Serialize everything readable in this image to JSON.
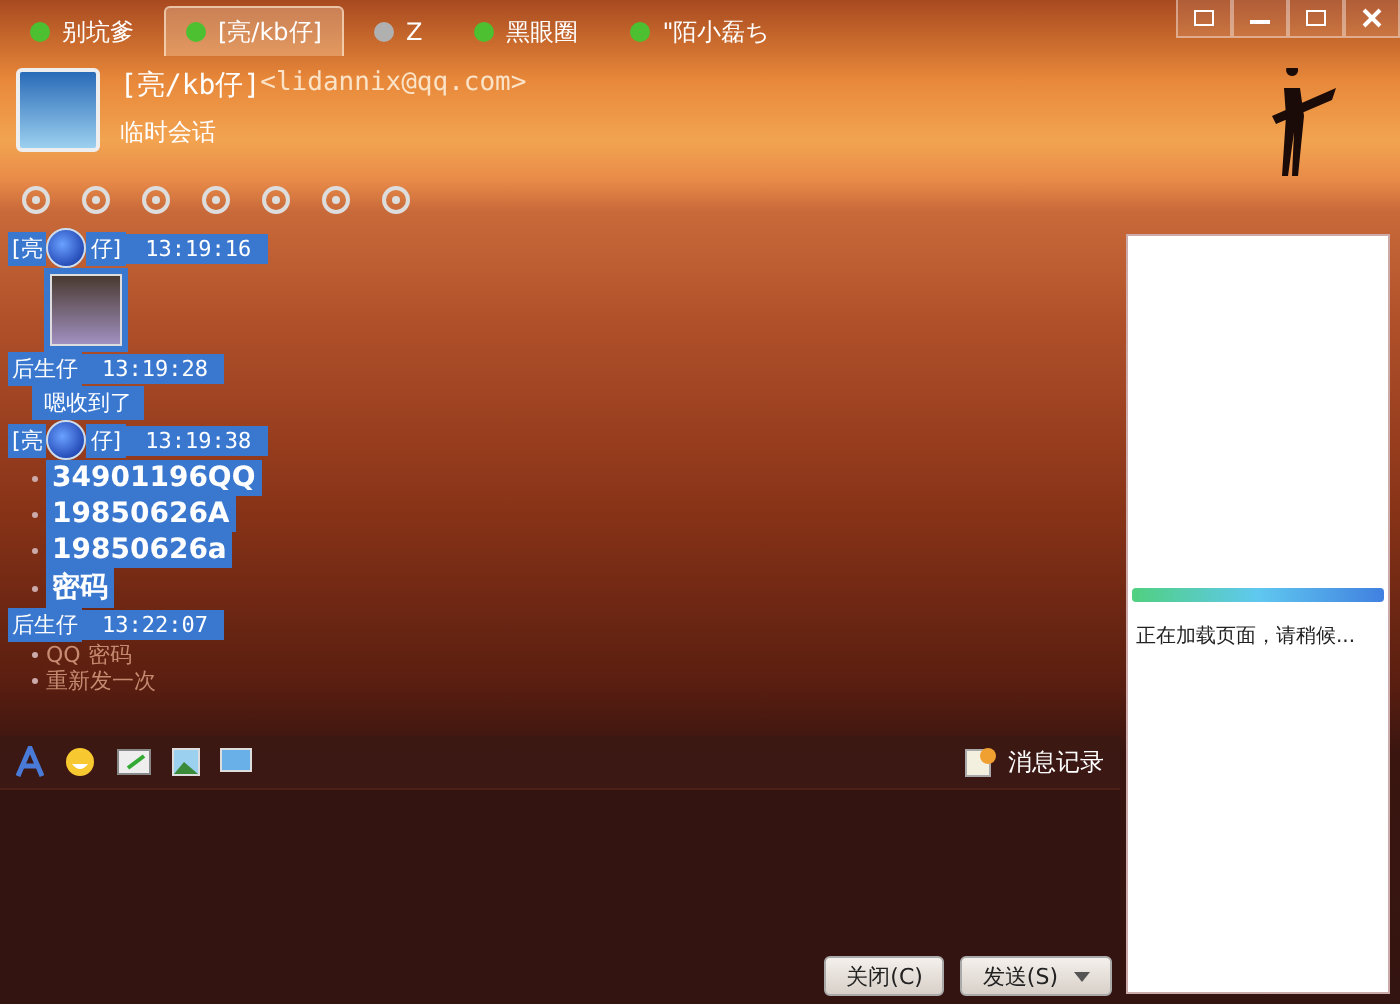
{
  "tabs": [
    {
      "label": "别坑爹",
      "color": "#4cc030",
      "selected": false
    },
    {
      "label": "[亮/kb仔]",
      "color": "#4cc030",
      "selected": true
    },
    {
      "label": "Z",
      "color": "#b0b0b0",
      "selected": false
    },
    {
      "label": "黑眼圈",
      "color": "#4cc030",
      "selected": false
    },
    {
      "label": "\"陌小磊ち",
      "color": "#4cc030",
      "selected": false
    }
  ],
  "contact": {
    "name": "[亮/kb仔]",
    "email": "<lidannix@qq.com>",
    "subtitle": "临时会话"
  },
  "messages": [
    {
      "sender": "[亮",
      "sender_tail": "仔]",
      "time": "13:19:16",
      "lines": [
        {
          "kind": "image"
        }
      ]
    },
    {
      "sender": "后生仔",
      "time": "13:19:28",
      "lines": [
        {
          "kind": "text",
          "text": "嗯收到了"
        }
      ]
    },
    {
      "sender": "[亮",
      "sender_tail": "仔]",
      "time": "13:19:38",
      "lines": [
        {
          "kind": "bullet",
          "text": "34901196QQ"
        },
        {
          "kind": "bullet",
          "text": "19850626A"
        },
        {
          "kind": "bullet",
          "text": "19850626a"
        },
        {
          "kind": "bullet",
          "text": "密码"
        }
      ]
    },
    {
      "sender": "后生仔",
      "time": "13:22:07",
      "lines": [
        {
          "kind": "faint",
          "text": "QQ 密码"
        },
        {
          "kind": "faint",
          "text": "重新发一次"
        }
      ]
    }
  ],
  "history_label": "消息记录",
  "side_panel": {
    "loading_text": "正在加载页面，请稍候...",
    "level": 1
  },
  "buttons": {
    "close": "关闭(C)",
    "send": "发送(S)"
  }
}
